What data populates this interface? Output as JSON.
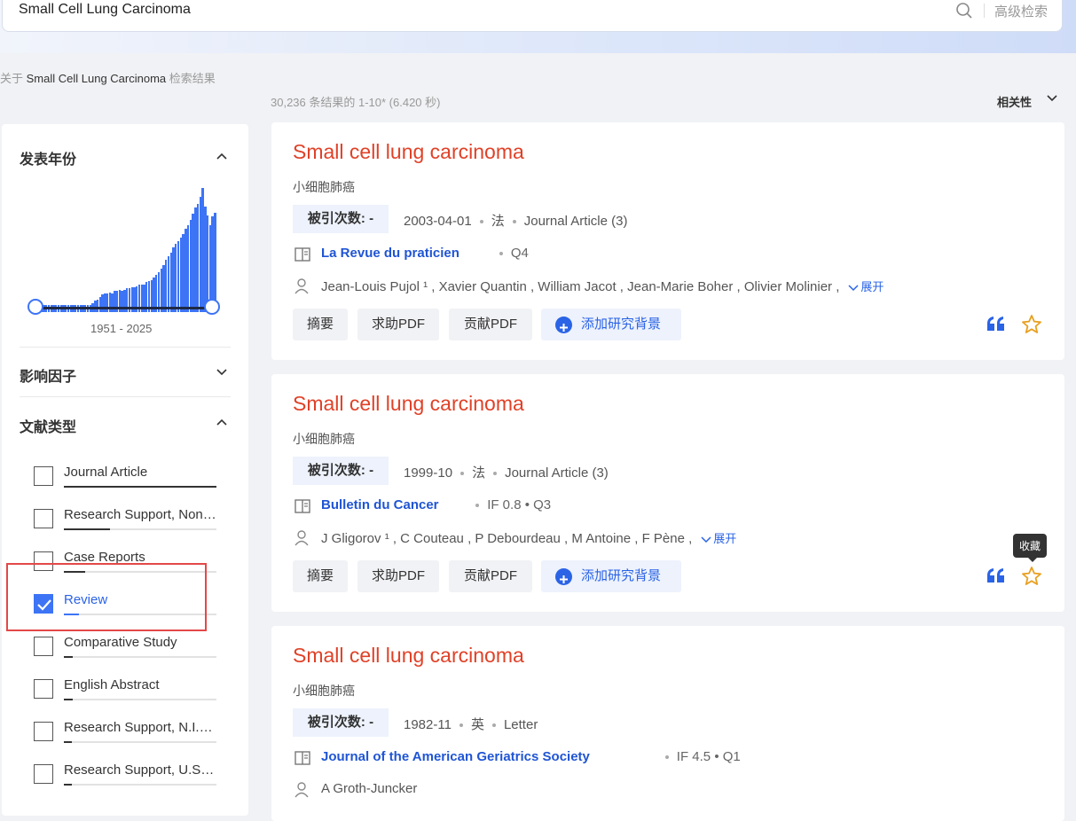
{
  "search": {
    "query": "Small Cell Lung Carcinoma",
    "advanced_label": "高级检索"
  },
  "query_line": {
    "prefix": "关于",
    "query": "Small Cell Lung Carcinoma",
    "suffix": "检索结果"
  },
  "result_count": "30,236 条结果的 1-10* (6.420 秒)",
  "sort_label": "相关性",
  "sidebar": {
    "year_facet": {
      "title": "发表年份",
      "range_label": "1951 - 2025",
      "histogram": [
        0.06,
        0.06,
        0.06,
        0.06,
        0.06,
        0.06,
        0.06,
        0.06,
        0.06,
        0.06,
        0.06,
        0.06,
        0.06,
        0.06,
        0.06,
        0.06,
        0.06,
        0.06,
        0.06,
        0.06,
        0.06,
        0.06,
        0.06,
        0.07,
        0.09,
        0.1,
        0.12,
        0.14,
        0.15,
        0.15,
        0.16,
        0.15,
        0.17,
        0.17,
        0.18,
        0.17,
        0.18,
        0.19,
        0.19,
        0.2,
        0.2,
        0.21,
        0.22,
        0.22,
        0.22,
        0.24,
        0.25,
        0.26,
        0.28,
        0.3,
        0.32,
        0.35,
        0.38,
        0.42,
        0.45,
        0.48,
        0.52,
        0.55,
        0.57,
        0.6,
        0.63,
        0.67,
        0.7,
        0.74,
        0.79,
        0.84,
        0.87,
        0.93,
        1.0,
        0.85,
        0.78,
        0.7,
        0.77,
        0.8
      ]
    },
    "impact_facet": {
      "title": "影响因子"
    },
    "type_facet": {
      "title": "文献类型",
      "items": [
        {
          "label": "Journal Article",
          "checked": false,
          "fill": 1.0
        },
        {
          "label": "Research Support, Non-U.S. Gov't",
          "checked": false,
          "fill": 0.3
        },
        {
          "label": "Case Reports",
          "checked": false,
          "fill": 0.14
        },
        {
          "label": "Review",
          "checked": true,
          "fill": 0.1
        },
        {
          "label": "Comparative Study",
          "checked": false,
          "fill": 0.06
        },
        {
          "label": "English Abstract",
          "checked": false,
          "fill": 0.06
        },
        {
          "label": "Research Support, N.I.H., Extramural",
          "checked": false,
          "fill": 0.05
        },
        {
          "label": "Research Support, U.S. Gov't, P.H.S.",
          "checked": false,
          "fill": 0.05
        }
      ]
    }
  },
  "results": [
    {
      "title": "Small cell lung carcinoma",
      "subtitle": "小细胞肺癌",
      "cited_label": "被引次数: -",
      "date": "2003-04-01",
      "lang": "法",
      "pub_type": "Journal Article (3)",
      "journal": "La Revue du praticien",
      "journal_meta": "Q4",
      "authors": "Jean-Louis Pujol ¹ ,  Xavier Quantin ,  William Jacot ,  Jean-Marie Boher ,  Olivier Molinier ,",
      "expand_label": "展开"
    },
    {
      "title": "Small cell lung carcinoma",
      "subtitle": "小细胞肺癌",
      "cited_label": "被引次数: -",
      "date": "1999-10",
      "lang": "法",
      "pub_type": "Journal Article (3)",
      "journal": "Bulletin du Cancer",
      "journal_meta": "IF 0.8  •  Q3",
      "authors": "J Gligorov ¹ ,  C Couteau ,  P Debourdeau ,  M Antoine ,  F Pène ,",
      "expand_label": "展开"
    },
    {
      "title": "Small cell lung carcinoma",
      "subtitle": "小细胞肺癌",
      "cited_label": "被引次数: -",
      "date": "1982-11",
      "lang": "英",
      "pub_type": "Letter",
      "journal": "Journal of the American Geriatrics Society",
      "journal_meta": "IF 4.5  •  Q1",
      "authors": "A Groth-Juncker",
      "expand_label": ""
    }
  ],
  "buttons": {
    "abstract": "摘要",
    "request_pdf": "求助PDF",
    "contribute_pdf": "贡献PDF",
    "add_context": "添加研究背景"
  },
  "tooltip": "收藏",
  "colors": {
    "accent": "#2a63e6",
    "title": "#e04127",
    "highlight": "#e34848"
  }
}
